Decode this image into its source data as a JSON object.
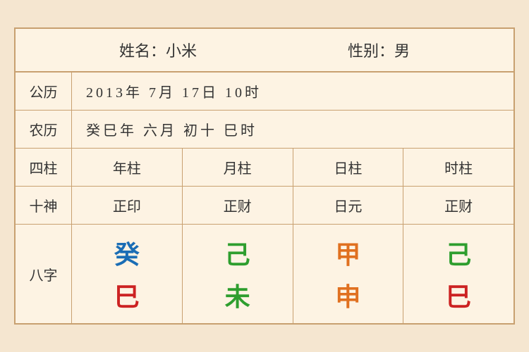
{
  "header": {
    "name_label": "姓名：小米",
    "gender_label": "性别：男"
  },
  "gregorian": {
    "label": "公历",
    "value": "2013年 7月 17日 10时"
  },
  "lunar": {
    "label": "农历",
    "value": "癸巳年 六月 初十 巳时"
  },
  "table": {
    "row_sizhu": {
      "label": "四柱",
      "cols": [
        "年柱",
        "月柱",
        "日柱",
        "时柱"
      ]
    },
    "row_shishen": {
      "label": "十神",
      "cols": [
        "正印",
        "正财",
        "日元",
        "正财"
      ]
    },
    "row_bazi": {
      "label": "八字",
      "tian": [
        "癸",
        "己",
        "甲",
        "己"
      ],
      "di": [
        "巳",
        "未",
        "申",
        "巳"
      ],
      "tian_colors": [
        "blue",
        "green",
        "orange",
        "green"
      ],
      "di_colors": [
        "red",
        "green",
        "orange",
        "red"
      ]
    }
  }
}
